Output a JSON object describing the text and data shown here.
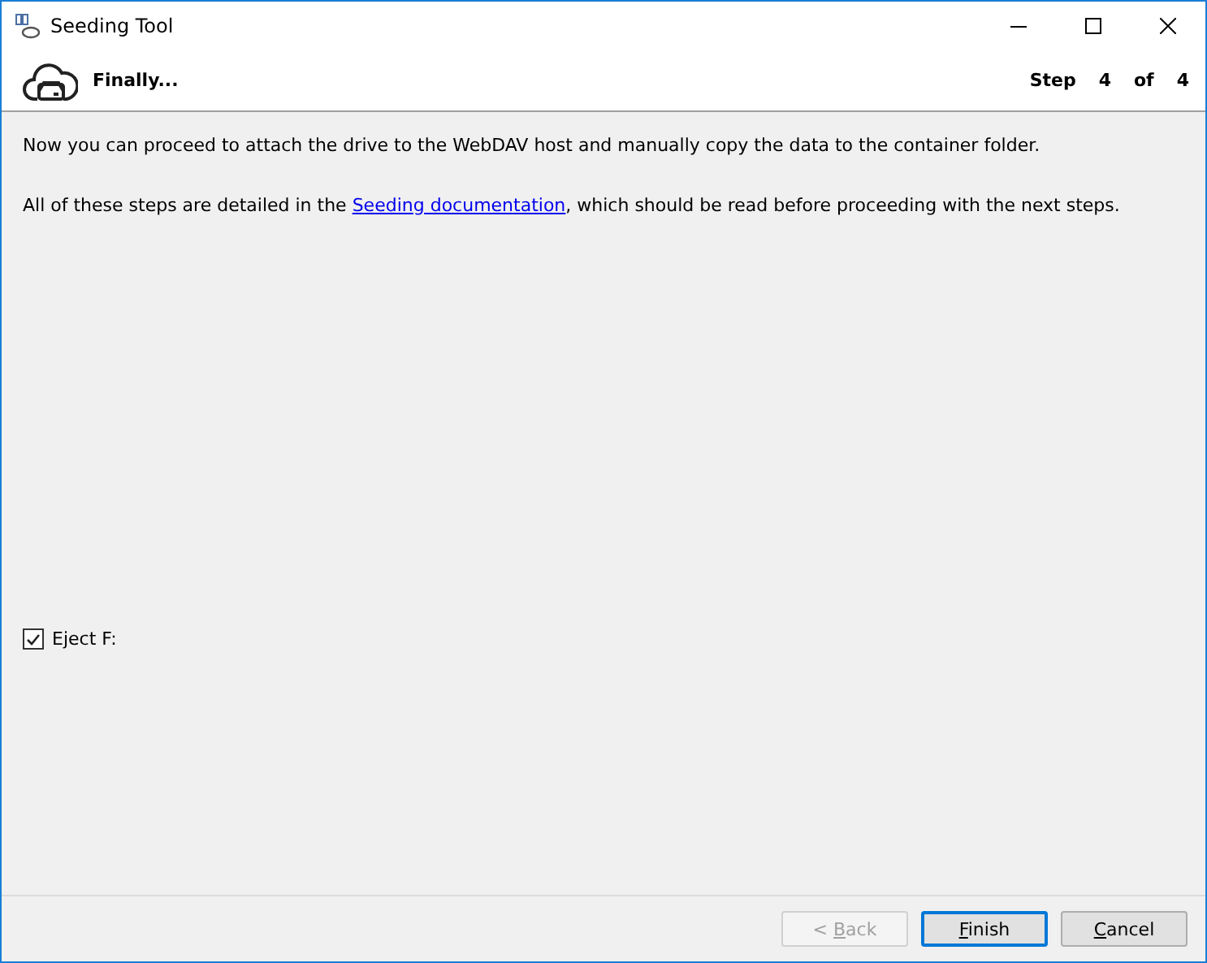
{
  "window": {
    "title": "Seeding Tool"
  },
  "header": {
    "title": "Finally...",
    "step_label": "Step",
    "step_current": "4",
    "step_of": "of",
    "step_total": "4"
  },
  "body": {
    "intro": "Now you can proceed to attach the drive to the WebDAV host and manually copy the data to the container folder.",
    "note": {
      "before": "All of these steps are detailed in the ",
      "link": "Seeding documentation",
      "after": ", which should be read before proceeding with the next steps."
    }
  },
  "eject": {
    "label": "Eject F:",
    "checked": true
  },
  "buttons": [
    {
      "before": "< ",
      "mnemonic": "B",
      "after": "ack",
      "disabled": true,
      "default": false
    },
    {
      "mnemonic": "F",
      "after": "inish",
      "disabled": false,
      "default": true
    },
    {
      "mnemonic": "C",
      "after": "ancel",
      "disabled": false,
      "default": false
    }
  ]
}
